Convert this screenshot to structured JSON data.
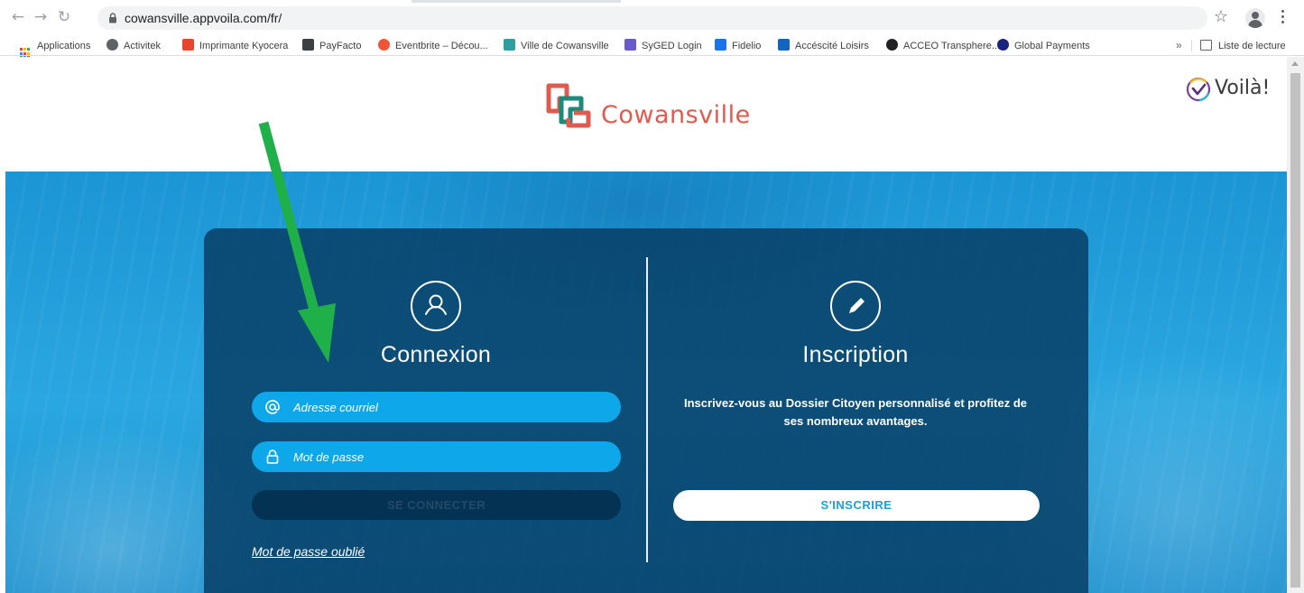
{
  "browser": {
    "url": "cowansville.appvoila.com/fr/",
    "bookmarks": [
      {
        "label": "Applications",
        "icon": "apps-grid-icon"
      },
      {
        "label": "Activitek",
        "icon": "activitek-icon",
        "color": "#5f6368"
      },
      {
        "label": "Imprimante Kyocera",
        "icon": "kyocera-icon",
        "color": "#e8442e"
      },
      {
        "label": "PayFacto",
        "icon": "payfacto-icon",
        "color": "#3c4043"
      },
      {
        "label": "Eventbrite – Décou...",
        "icon": "eventbrite-icon",
        "color": "#f05537"
      },
      {
        "label": "Ville de Cowansville",
        "icon": "cowansville-icon",
        "color": "#2f9ea0"
      },
      {
        "label": "SyGED Login",
        "icon": "syged-icon",
        "color": "#6a5acd"
      },
      {
        "label": "Fidelio",
        "icon": "fidelio-icon",
        "color": "#1a73e8"
      },
      {
        "label": "Accéscité Loisirs",
        "icon": "accescite-icon",
        "color": "#1565c0"
      },
      {
        "label": "ACCEO Transphere...",
        "icon": "acceo-icon",
        "color": "#202124"
      },
      {
        "label": "Global Payments",
        "icon": "global-payments-icon",
        "color": "#1a237e"
      }
    ],
    "more_label": "»",
    "reading_list_label": "Liste de lecture"
  },
  "header": {
    "logo_text": "Cowansville",
    "voila_text": "Voilà!"
  },
  "login": {
    "title": "Connexion",
    "email_placeholder": "Adresse courriel",
    "password_placeholder": "Mot de passe",
    "submit_label": "SE CONNECTER",
    "forgot_label": "Mot de passe oublié"
  },
  "signup": {
    "title": "Inscription",
    "description": "Inscrivez-vous au Dossier Citoyen personnalisé et profitez de ses nombreux avantages.",
    "button_label": "S'INSCRIRE"
  },
  "colors": {
    "brand_red": "#e05a4e",
    "brand_teal": "#1d8a7a",
    "field_blue": "#0ea8ea",
    "panel": "#063a60",
    "annotation_arrow": "#1fb04a"
  }
}
